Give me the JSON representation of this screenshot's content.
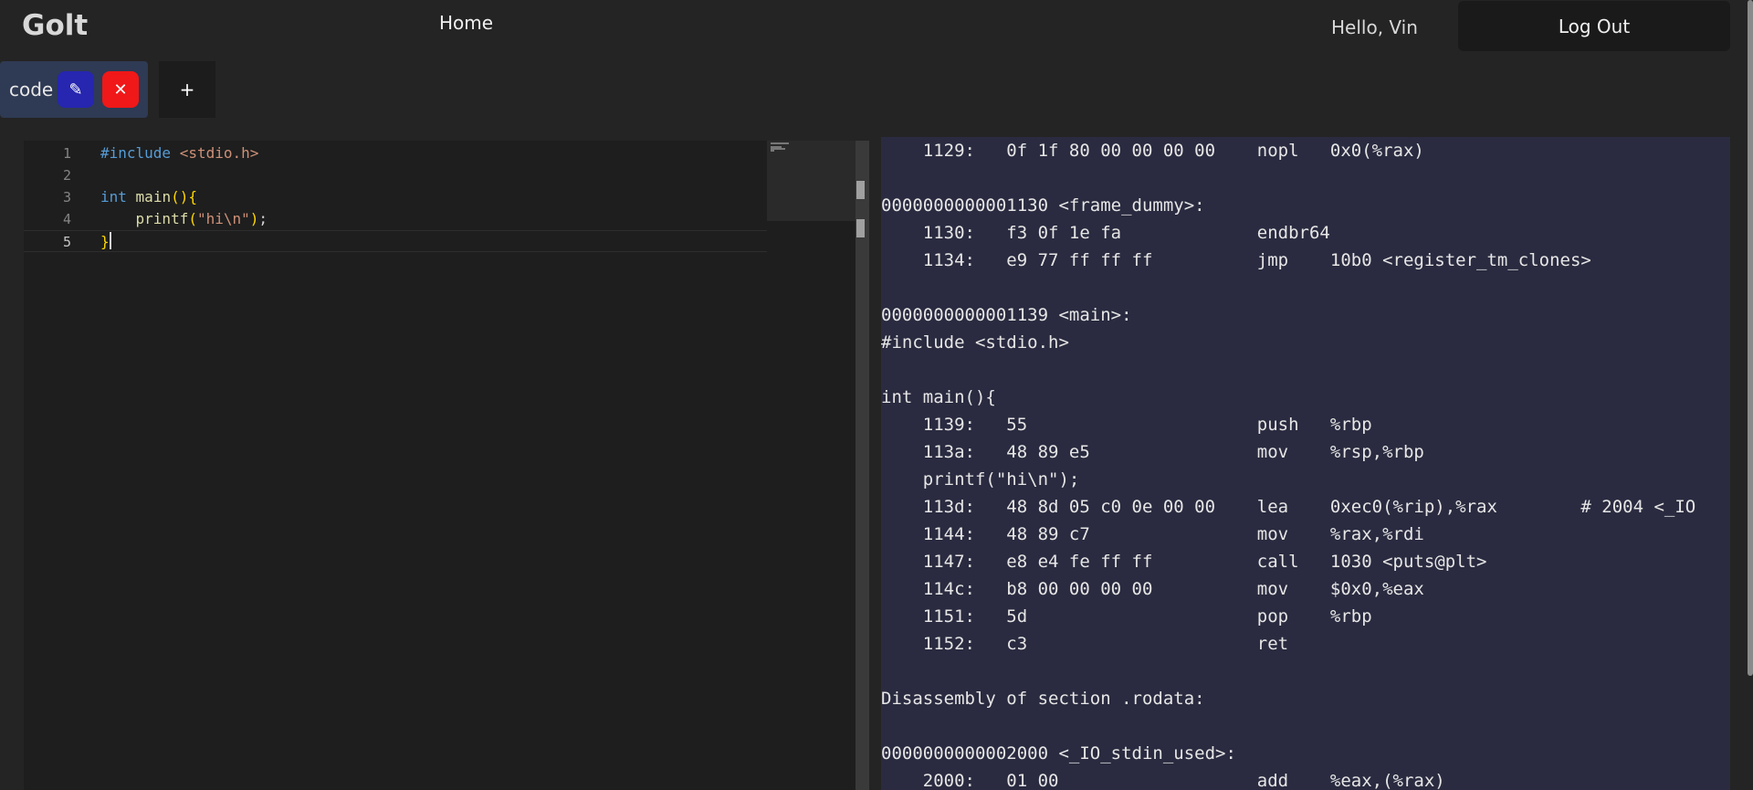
{
  "nav": {
    "brand": "Golt",
    "home": "Home",
    "greeting": "Hello, Vin",
    "logout": "Log Out"
  },
  "tabs": [
    {
      "label": "code",
      "edit_icon": "✎",
      "close_icon": "✕"
    }
  ],
  "add_tab": "+",
  "editor": {
    "lines": [
      {
        "num": "1",
        "text": "#include <stdio.h>"
      },
      {
        "num": "2",
        "text": ""
      },
      {
        "num": "3",
        "text": "int main(){"
      },
      {
        "num": "4",
        "text": "    printf(\"hi\\n\");"
      },
      {
        "num": "5",
        "text": "}"
      }
    ],
    "active_line": 5
  },
  "disassembly": [
    "    1129:   0f 1f 80 00 00 00 00    nopl   0x0(%rax)",
    "",
    "0000000000001130 <frame_dummy>:",
    "    1130:   f3 0f 1e fa             endbr64",
    "    1134:   e9 77 ff ff ff          jmp    10b0 <register_tm_clones>",
    "",
    "0000000000001139 <main>:",
    "#include <stdio.h>",
    "",
    "int main(){",
    "    1139:   55                      push   %rbp",
    "    113a:   48 89 e5                mov    %rsp,%rbp",
    "    printf(\"hi\\n\");",
    "    113d:   48 8d 05 c0 0e 00 00    lea    0xec0(%rip),%rax        # 2004 <_IO",
    "    1144:   48 89 c7                mov    %rax,%rdi",
    "    1147:   e8 e4 fe ff ff          call   1030 <puts@plt>",
    "    114c:   b8 00 00 00 00          mov    $0x0,%eax",
    "    1151:   5d                      pop    %rbp",
    "    1152:   c3                      ret",
    "",
    "Disassembly of section .rodata:",
    "",
    "0000000000002000 <_IO_stdin_used>:",
    "    2000:   01 00                   add    %eax,(%rax)"
  ]
}
